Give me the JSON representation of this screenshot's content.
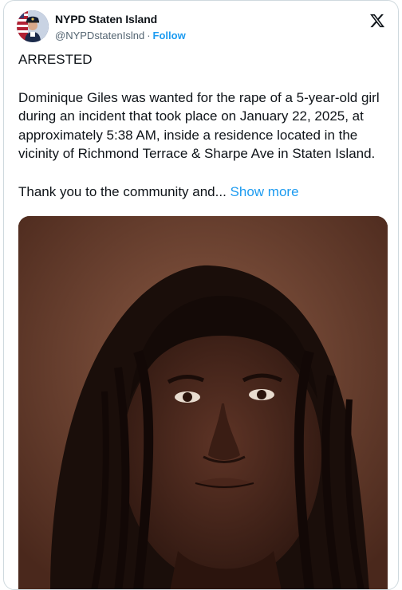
{
  "account": {
    "display_name": "NYPD Staten Island",
    "handle": "@NYPDstatenIslnd",
    "separator": "·",
    "follow_label": "Follow"
  },
  "icons": {
    "brand": "x-logo-icon",
    "avatar": "police-officer-avatar"
  },
  "tweet": {
    "line1": "ARRESTED",
    "line2": "Dominique Giles was wanted for the rape of a 5-year-old girl during an incident that took place on January 22, 2025, at approximately 5:38 AM, inside a residence located in the vicinity of Richmond Terrace & Sharpe Ave in Staten Island.",
    "line3": "Thank you to the community and...",
    "show_more_label": "Show more"
  },
  "colors": {
    "accent": "#1d9bf0",
    "text": "#0f1419",
    "muted": "#536471",
    "border": "#cfd9de"
  }
}
